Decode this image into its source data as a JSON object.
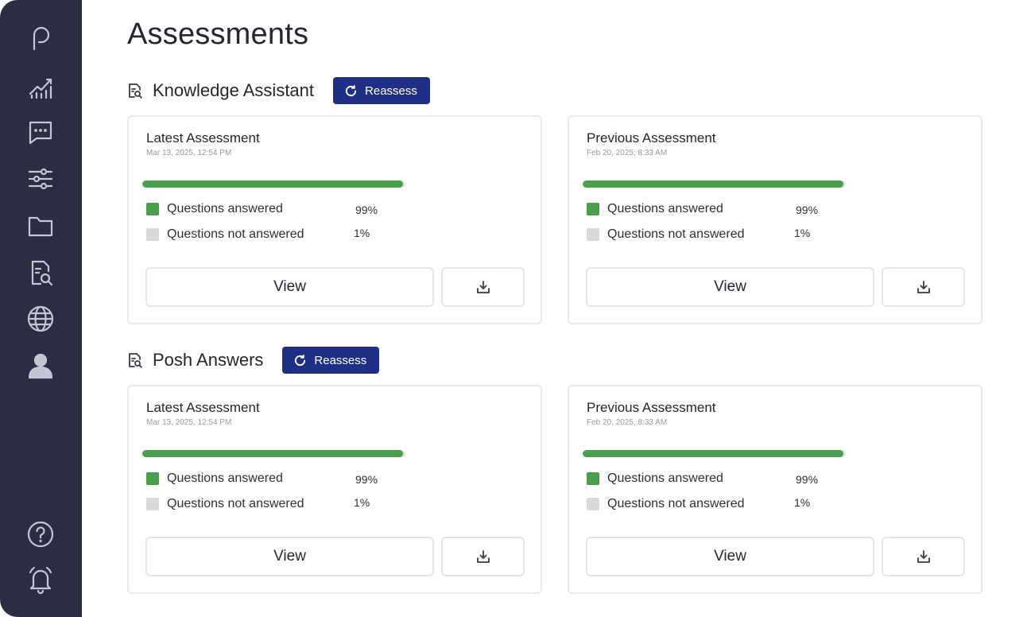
{
  "page": {
    "title": "Assessments"
  },
  "sidebar": {
    "items": [
      {
        "icon": "logo-p-icon"
      },
      {
        "icon": "analytics-icon"
      },
      {
        "icon": "chat-icon"
      },
      {
        "icon": "sliders-icon"
      },
      {
        "icon": "folder-icon"
      },
      {
        "icon": "document-search-icon"
      },
      {
        "icon": "globe-icon"
      },
      {
        "icon": "user-icon"
      },
      {
        "icon": "help-icon"
      },
      {
        "icon": "bell-icon"
      }
    ]
  },
  "colors": {
    "accent": "#1f2f86",
    "answered": "#4a9f4f",
    "not_answered": "#d9d9dc",
    "sidebar": "#2b2d42"
  },
  "sections": [
    {
      "title": "Knowledge Assistant",
      "reassess_label": "Reassess",
      "cards": [
        {
          "title": "Latest Assessment",
          "date": "Mar 13, 2025, 12:54 PM",
          "progress": 0.99,
          "answered_label": "Questions answered",
          "answered_value": "99%",
          "not_answered_label": "Questions not answered",
          "not_answered_value": "1%",
          "view_label": "View"
        },
        {
          "title": "Previous Assessment",
          "date": "Feb 20, 2025, 8:33 AM",
          "progress": 0.99,
          "answered_label": "Questions answered",
          "answered_value": "99%",
          "not_answered_label": "Questions not answered",
          "not_answered_value": "1%",
          "view_label": "View"
        }
      ]
    },
    {
      "title": "Posh Answers",
      "reassess_label": "Reassess",
      "cards": [
        {
          "title": "Latest Assessment",
          "date": "Mar 13, 2025, 12:54 PM",
          "progress": 0.99,
          "answered_label": "Questions answered",
          "answered_value": "99%",
          "not_answered_label": "Questions not answered",
          "not_answered_value": "1%",
          "view_label": "View"
        },
        {
          "title": "Previous Assessment",
          "date": "Feb 20, 2025, 8:33 AM",
          "progress": 0.99,
          "answered_label": "Questions answered",
          "answered_value": "99%",
          "not_answered_label": "Questions not answered",
          "not_answered_value": "1%",
          "view_label": "View"
        }
      ]
    }
  ]
}
